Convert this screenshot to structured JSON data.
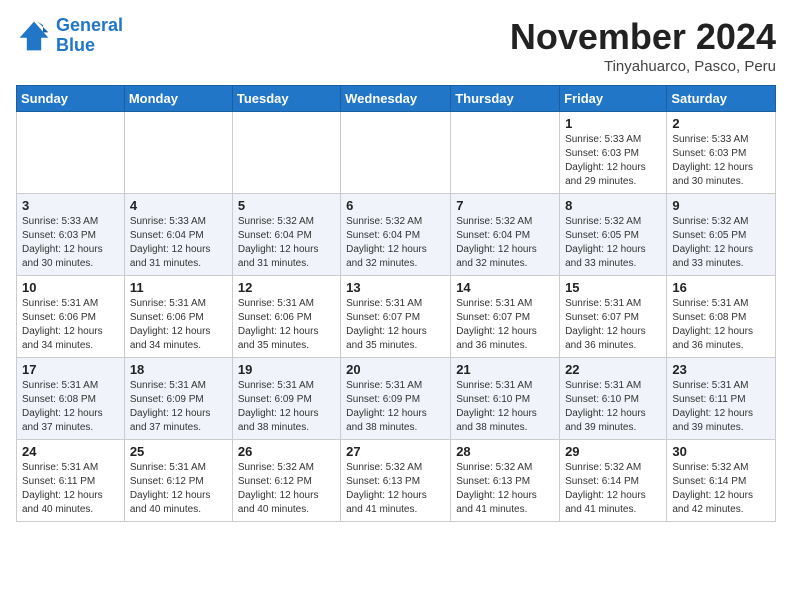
{
  "header": {
    "logo_line1": "General",
    "logo_line2": "Blue",
    "month": "November 2024",
    "location": "Tinyahuarco, Pasco, Peru"
  },
  "days_of_week": [
    "Sunday",
    "Monday",
    "Tuesday",
    "Wednesday",
    "Thursday",
    "Friday",
    "Saturday"
  ],
  "weeks": [
    [
      {
        "day": "",
        "info": ""
      },
      {
        "day": "",
        "info": ""
      },
      {
        "day": "",
        "info": ""
      },
      {
        "day": "",
        "info": ""
      },
      {
        "day": "",
        "info": ""
      },
      {
        "day": "1",
        "info": "Sunrise: 5:33 AM\nSunset: 6:03 PM\nDaylight: 12 hours and 29 minutes."
      },
      {
        "day": "2",
        "info": "Sunrise: 5:33 AM\nSunset: 6:03 PM\nDaylight: 12 hours and 30 minutes."
      }
    ],
    [
      {
        "day": "3",
        "info": "Sunrise: 5:33 AM\nSunset: 6:03 PM\nDaylight: 12 hours and 30 minutes."
      },
      {
        "day": "4",
        "info": "Sunrise: 5:33 AM\nSunset: 6:04 PM\nDaylight: 12 hours and 31 minutes."
      },
      {
        "day": "5",
        "info": "Sunrise: 5:32 AM\nSunset: 6:04 PM\nDaylight: 12 hours and 31 minutes."
      },
      {
        "day": "6",
        "info": "Sunrise: 5:32 AM\nSunset: 6:04 PM\nDaylight: 12 hours and 32 minutes."
      },
      {
        "day": "7",
        "info": "Sunrise: 5:32 AM\nSunset: 6:04 PM\nDaylight: 12 hours and 32 minutes."
      },
      {
        "day": "8",
        "info": "Sunrise: 5:32 AM\nSunset: 6:05 PM\nDaylight: 12 hours and 33 minutes."
      },
      {
        "day": "9",
        "info": "Sunrise: 5:32 AM\nSunset: 6:05 PM\nDaylight: 12 hours and 33 minutes."
      }
    ],
    [
      {
        "day": "10",
        "info": "Sunrise: 5:31 AM\nSunset: 6:06 PM\nDaylight: 12 hours and 34 minutes."
      },
      {
        "day": "11",
        "info": "Sunrise: 5:31 AM\nSunset: 6:06 PM\nDaylight: 12 hours and 34 minutes."
      },
      {
        "day": "12",
        "info": "Sunrise: 5:31 AM\nSunset: 6:06 PM\nDaylight: 12 hours and 35 minutes."
      },
      {
        "day": "13",
        "info": "Sunrise: 5:31 AM\nSunset: 6:07 PM\nDaylight: 12 hours and 35 minutes."
      },
      {
        "day": "14",
        "info": "Sunrise: 5:31 AM\nSunset: 6:07 PM\nDaylight: 12 hours and 36 minutes."
      },
      {
        "day": "15",
        "info": "Sunrise: 5:31 AM\nSunset: 6:07 PM\nDaylight: 12 hours and 36 minutes."
      },
      {
        "day": "16",
        "info": "Sunrise: 5:31 AM\nSunset: 6:08 PM\nDaylight: 12 hours and 36 minutes."
      }
    ],
    [
      {
        "day": "17",
        "info": "Sunrise: 5:31 AM\nSunset: 6:08 PM\nDaylight: 12 hours and 37 minutes."
      },
      {
        "day": "18",
        "info": "Sunrise: 5:31 AM\nSunset: 6:09 PM\nDaylight: 12 hours and 37 minutes."
      },
      {
        "day": "19",
        "info": "Sunrise: 5:31 AM\nSunset: 6:09 PM\nDaylight: 12 hours and 38 minutes."
      },
      {
        "day": "20",
        "info": "Sunrise: 5:31 AM\nSunset: 6:09 PM\nDaylight: 12 hours and 38 minutes."
      },
      {
        "day": "21",
        "info": "Sunrise: 5:31 AM\nSunset: 6:10 PM\nDaylight: 12 hours and 38 minutes."
      },
      {
        "day": "22",
        "info": "Sunrise: 5:31 AM\nSunset: 6:10 PM\nDaylight: 12 hours and 39 minutes."
      },
      {
        "day": "23",
        "info": "Sunrise: 5:31 AM\nSunset: 6:11 PM\nDaylight: 12 hours and 39 minutes."
      }
    ],
    [
      {
        "day": "24",
        "info": "Sunrise: 5:31 AM\nSunset: 6:11 PM\nDaylight: 12 hours and 40 minutes."
      },
      {
        "day": "25",
        "info": "Sunrise: 5:31 AM\nSunset: 6:12 PM\nDaylight: 12 hours and 40 minutes."
      },
      {
        "day": "26",
        "info": "Sunrise: 5:32 AM\nSunset: 6:12 PM\nDaylight: 12 hours and 40 minutes."
      },
      {
        "day": "27",
        "info": "Sunrise: 5:32 AM\nSunset: 6:13 PM\nDaylight: 12 hours and 41 minutes."
      },
      {
        "day": "28",
        "info": "Sunrise: 5:32 AM\nSunset: 6:13 PM\nDaylight: 12 hours and 41 minutes."
      },
      {
        "day": "29",
        "info": "Sunrise: 5:32 AM\nSunset: 6:14 PM\nDaylight: 12 hours and 41 minutes."
      },
      {
        "day": "30",
        "info": "Sunrise: 5:32 AM\nSunset: 6:14 PM\nDaylight: 12 hours and 42 minutes."
      }
    ]
  ]
}
